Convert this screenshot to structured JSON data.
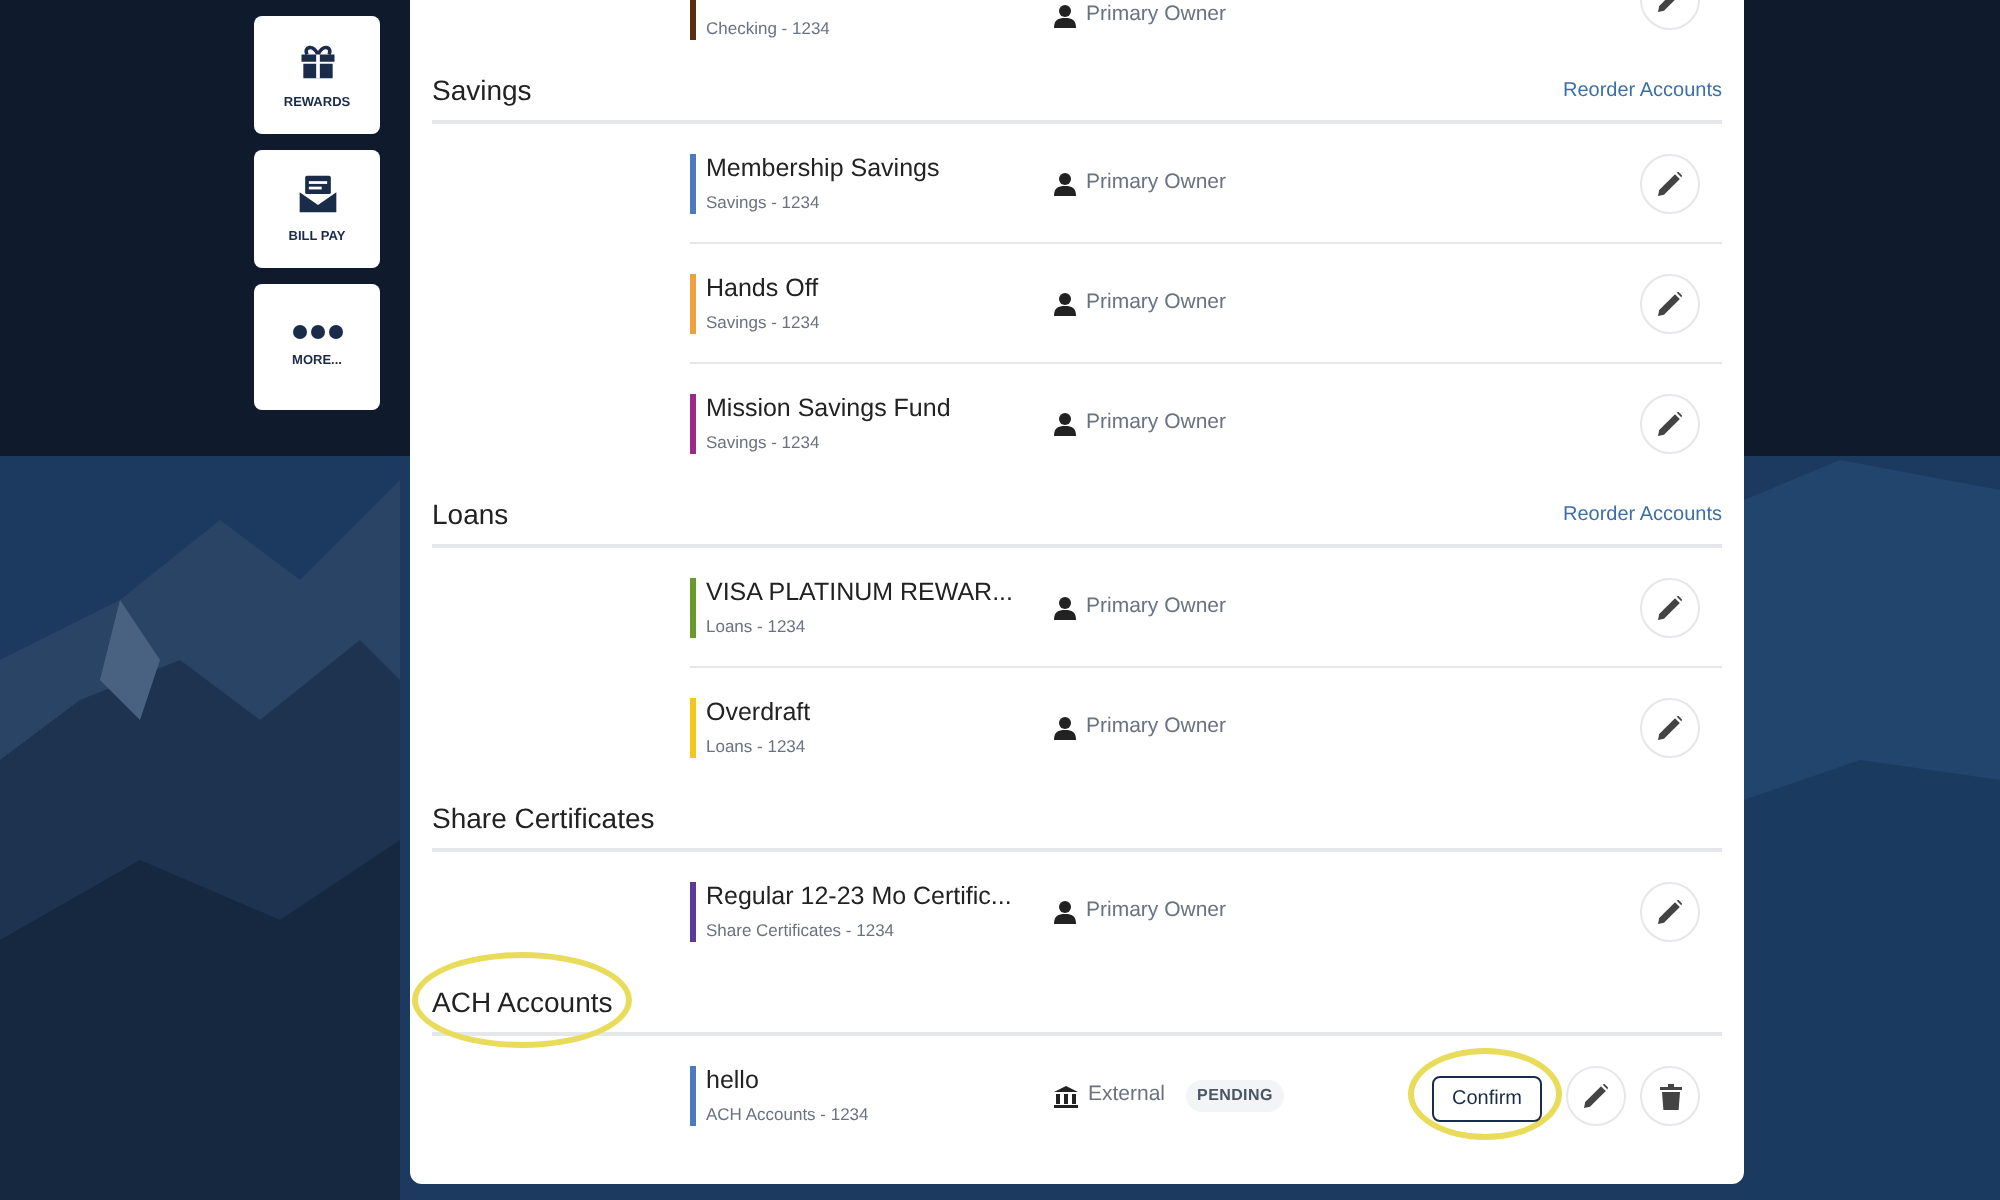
{
  "nav_tiles": [
    {
      "kind": "gift",
      "label": "REWARDS"
    },
    {
      "kind": "bill",
      "label": "BILL PAY"
    },
    {
      "kind": "dots",
      "label": "MORE..."
    }
  ],
  "partial_row": {
    "subtitle": "Checking - 1234",
    "color": "#5a2e0e",
    "owner": "Primary Owner"
  },
  "sections": [
    {
      "title": "Savings",
      "link": "Reorder Accounts",
      "highlighted": false,
      "accounts": [
        {
          "name": "Membership Savings",
          "subtitle": "Savings - 1234",
          "color": "#4a7bbf",
          "kind": "member",
          "owner": "Primary Owner"
        },
        {
          "name": "Hands Off",
          "subtitle": "Savings - 1234",
          "color": "#f0a040",
          "kind": "member",
          "owner": "Primary Owner"
        },
        {
          "name": "Mission Savings Fund",
          "subtitle": "Savings - 1234",
          "color": "#9b2a8a",
          "kind": "member",
          "owner": "Primary Owner"
        }
      ]
    },
    {
      "title": "Loans",
      "link": "Reorder Accounts",
      "highlighted": false,
      "accounts": [
        {
          "name": "VISA PLATINUM REWAR...",
          "subtitle": "Loans - 1234",
          "color": "#6a9a2a",
          "kind": "member",
          "owner": "Primary Owner"
        },
        {
          "name": "Overdraft",
          "subtitle": "Loans - 1234",
          "color": "#f2c81a",
          "kind": "member",
          "owner": "Primary Owner"
        }
      ]
    },
    {
      "title": "Share Certificates",
      "highlighted": false,
      "accounts": [
        {
          "name": "Regular 12-23 Mo Certific...",
          "subtitle": "Share Certificates - 1234",
          "color": "#5b3a9b",
          "kind": "member",
          "owner": "Primary Owner"
        }
      ]
    },
    {
      "title": "ACH Accounts",
      "highlighted": true,
      "accounts": [
        {
          "name": "hello",
          "subtitle": "ACH Accounts - 1234",
          "color": "#4a7bbf",
          "kind": "external",
          "owner": "External",
          "badge": "PENDING",
          "confirm": {
            "label": "Confirm",
            "highlighted": true
          },
          "deletable": true
        }
      ]
    }
  ]
}
